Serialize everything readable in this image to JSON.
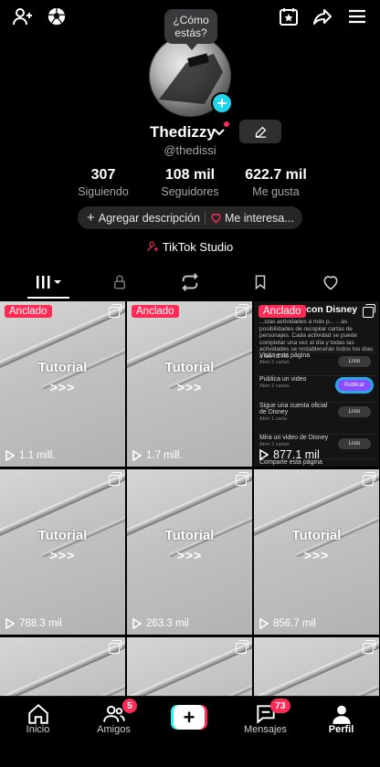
{
  "topbar": {
    "icons": [
      "add-friend-icon",
      "soccer-ball-icon",
      "calendar-star-icon",
      "share-icon",
      "menu-icon"
    ]
  },
  "profile": {
    "bubble_text": "¿Cómo estás?",
    "display_name": "Thedizzy",
    "username": "@thedissi"
  },
  "stats": [
    {
      "value": "307",
      "label": "Siguiendo"
    },
    {
      "value": "108 mil",
      "label": "Seguidores"
    },
    {
      "value": "622.7 mil",
      "label": "Me gusta"
    }
  ],
  "actions": {
    "add_description": "Agregar descripción",
    "interests": "Me interesa..."
  },
  "studio_label": "TikTok Studio",
  "tabs": [
    "videos-grid-icon",
    "lock-icon",
    "repost-icon",
    "bookmark-icon",
    "heart-icon"
  ],
  "grid": {
    "pinned_label": "Anclado",
    "tutorial_title": "Tutorial",
    "tutorial_arrows": ">>>",
    "views": [
      "1.1 mill.",
      "1.7 mill.",
      "877.1 mil",
      "788.3 mil",
      "263.3 mil",
      "856.7 mil"
    ],
    "disney": {
      "title": "Juega con Disney",
      "subtitle": "...stas actividades a más p... ...as posibilidades de recopilar cartas de personajes. Cada actividad se puede completar una vez al día y todas las actividades se restablecerán todos los días a las 02:00.",
      "rows": [
        {
          "title": "Visita esta página",
          "sub": "Abrir 2 cartas",
          "button": "Listo"
        },
        {
          "title": "Publica un video",
          "sub": "Abrir 2 cartas",
          "button": "Publicar"
        },
        {
          "title": "Sigue una cuenta oficial de Disney",
          "sub": "Abrir 1 carta",
          "button": "Listo"
        },
        {
          "title": "Mira un video de Disney",
          "sub": "Abrir 2 cartas",
          "button": "Listo"
        },
        {
          "title": "Comparte esta página",
          "sub": "",
          "button": ""
        }
      ]
    }
  },
  "bottom_nav": [
    {
      "label": "Inicio",
      "icon": "home-icon",
      "badge": ""
    },
    {
      "label": "Amigos",
      "icon": "friends-icon",
      "badge": "5"
    },
    {
      "label": "",
      "icon": "create-plus-icon",
      "badge": ""
    },
    {
      "label": "Mensajes",
      "icon": "inbox-icon",
      "badge": "73"
    },
    {
      "label": "Perfil",
      "icon": "profile-icon",
      "badge": ""
    }
  ],
  "colors": {
    "accent_red": "#fe2c55",
    "accent_cyan": "#25f4ee",
    "avatar_plus": "#20d5ec"
  }
}
